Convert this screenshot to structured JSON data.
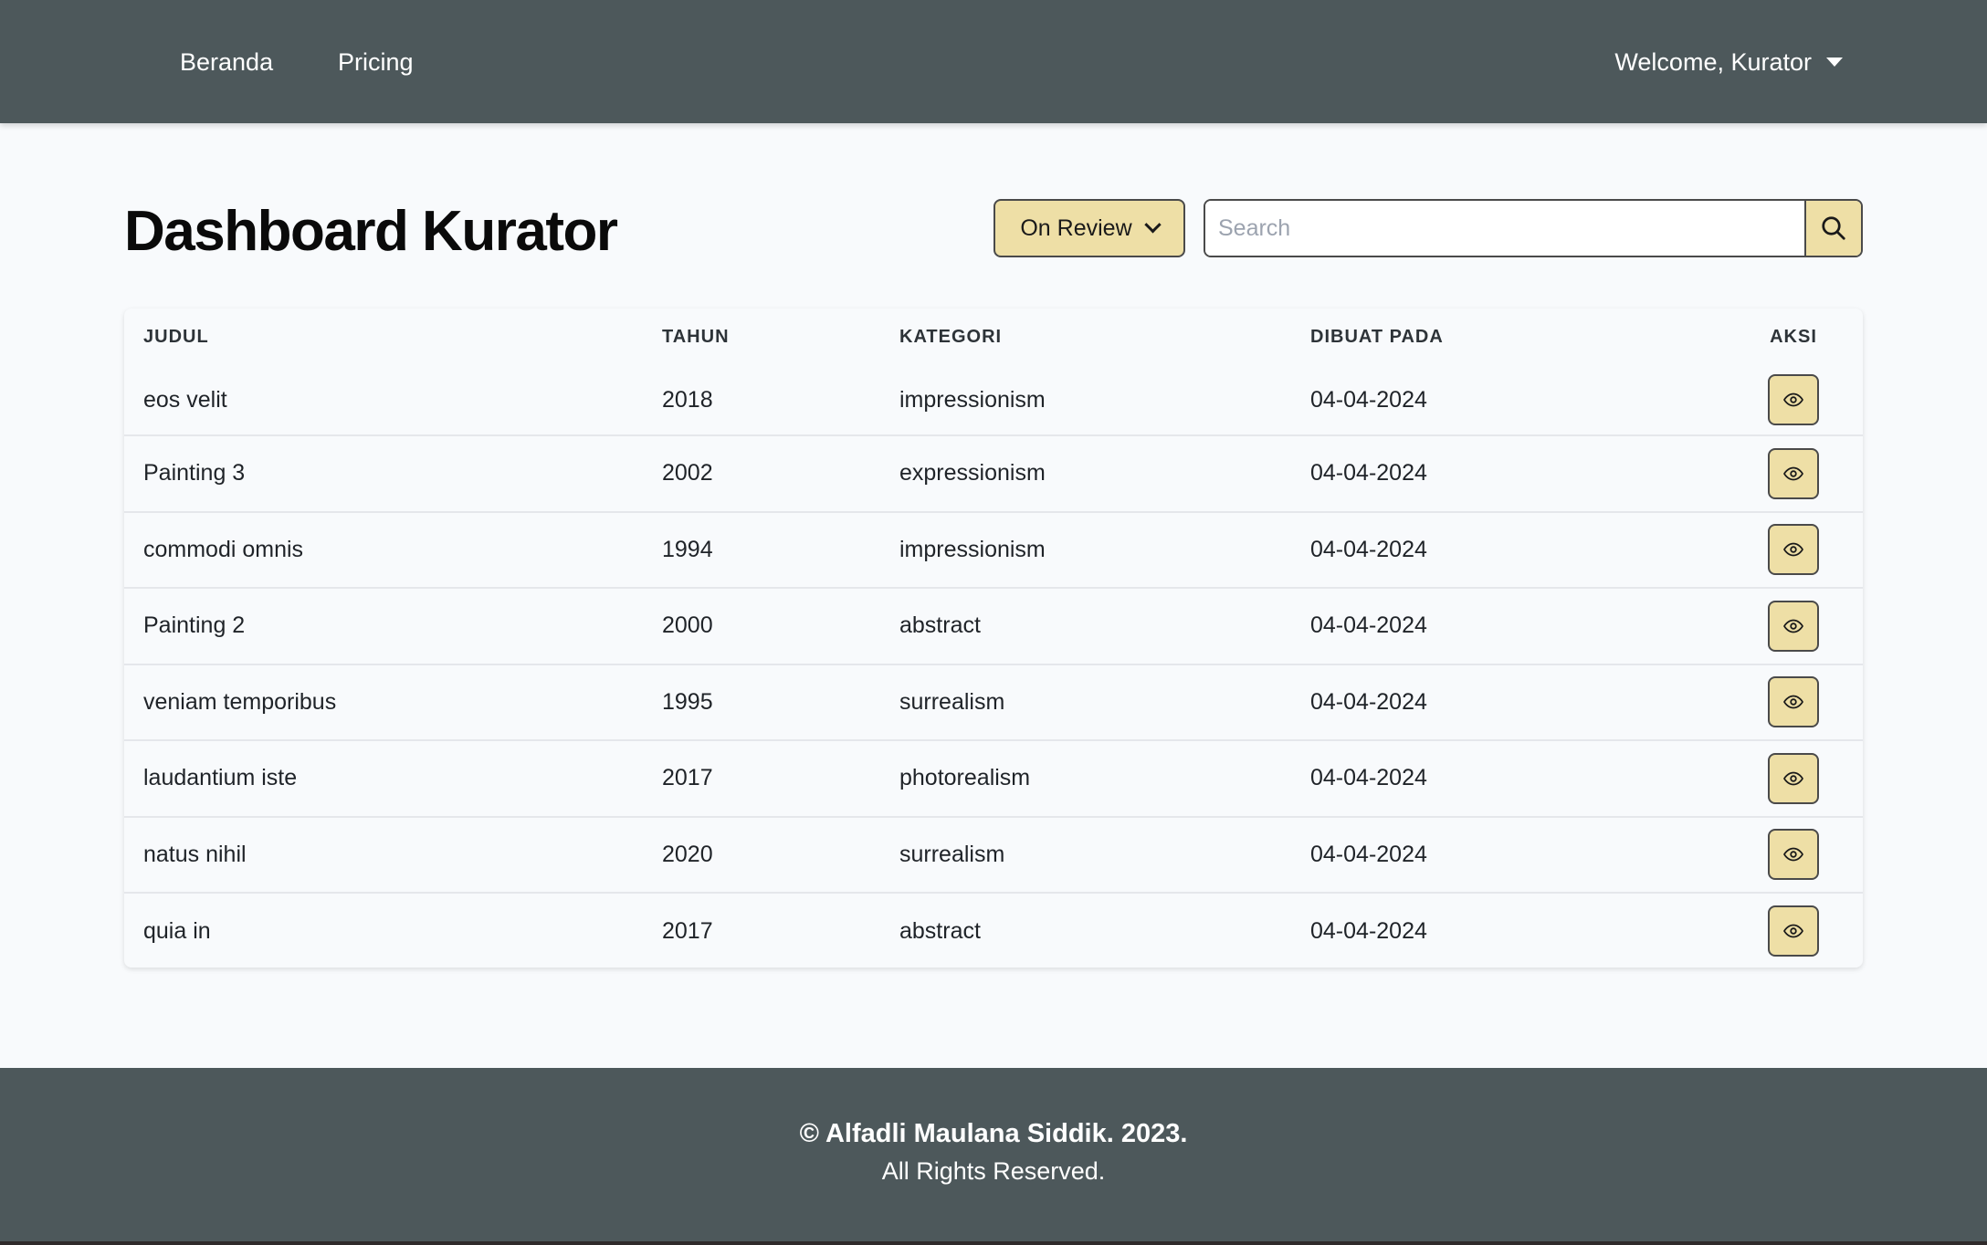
{
  "nav": {
    "links": [
      "Beranda",
      "Pricing"
    ],
    "user_label": "Welcome, Kurator"
  },
  "page": {
    "title": "Dashboard Kurator",
    "filter_label": "On Review",
    "search_placeholder": "Search"
  },
  "table": {
    "headers": [
      "JUDUL",
      "TAHUN",
      "KATEGORI",
      "DIBUAT PADA",
      "AKSI"
    ],
    "rows": [
      {
        "judul": "eos velit",
        "tahun": "2018",
        "kategori": "impressionism",
        "dibuat": "04-04-2024"
      },
      {
        "judul": "Painting 3",
        "tahun": "2002",
        "kategori": "expressionism",
        "dibuat": "04-04-2024"
      },
      {
        "judul": "commodi omnis",
        "tahun": "1994",
        "kategori": "impressionism",
        "dibuat": "04-04-2024"
      },
      {
        "judul": "Painting 2",
        "tahun": "2000",
        "kategori": "abstract",
        "dibuat": "04-04-2024"
      },
      {
        "judul": "veniam temporibus",
        "tahun": "1995",
        "kategori": "surrealism",
        "dibuat": "04-04-2024"
      },
      {
        "judul": "laudantium iste",
        "tahun": "2017",
        "kategori": "photorealism",
        "dibuat": "04-04-2024"
      },
      {
        "judul": "natus nihil",
        "tahun": "2020",
        "kategori": "surrealism",
        "dibuat": "04-04-2024"
      },
      {
        "judul": "quia in",
        "tahun": "2017",
        "kategori": "abstract",
        "dibuat": "04-04-2024"
      }
    ],
    "action_icon": "eye-icon"
  },
  "footer": {
    "line1": "© Alfadli Maulana Siddik. 2023.",
    "line2": "All Rights Reserved."
  },
  "colors": {
    "nav_bg": "#4d585b",
    "accent": "#eedfa6",
    "page_bg": "#f8fafc"
  }
}
